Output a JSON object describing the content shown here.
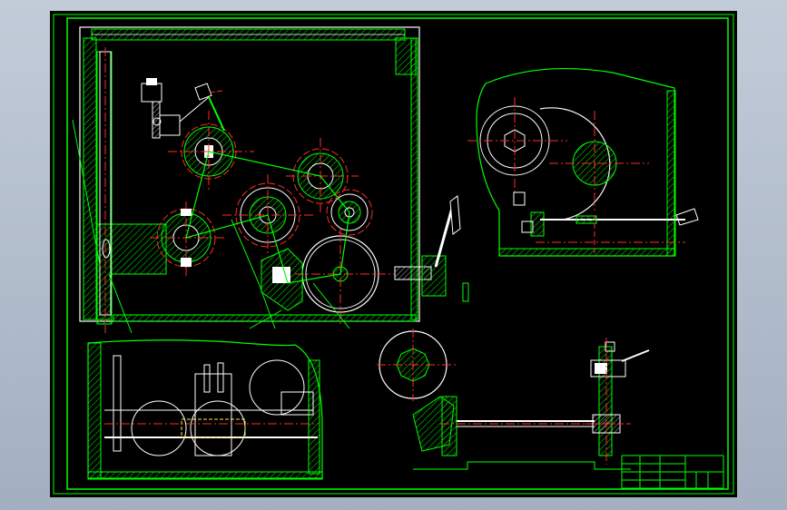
{
  "drawing": {
    "type": "mechanical assembly drawing",
    "background_color": "#000000",
    "line_color": "#00ff00",
    "centerline_color": "#ff2a2a",
    "detail_line_color": "#ffffff",
    "hatch_color": "#00cc00",
    "title_block": {
      "cells": [
        "",
        "",
        "",
        "",
        "",
        ""
      ]
    },
    "views": [
      {
        "name": "main-section-view",
        "label": ""
      },
      {
        "name": "side-view",
        "label": ""
      },
      {
        "name": "top-section-view",
        "label": ""
      },
      {
        "name": "partial-view",
        "label": ""
      },
      {
        "name": "detail-view",
        "label": ""
      }
    ]
  },
  "icons": {
    "lever-handle": "lever-icon",
    "gear": "gear-icon"
  }
}
